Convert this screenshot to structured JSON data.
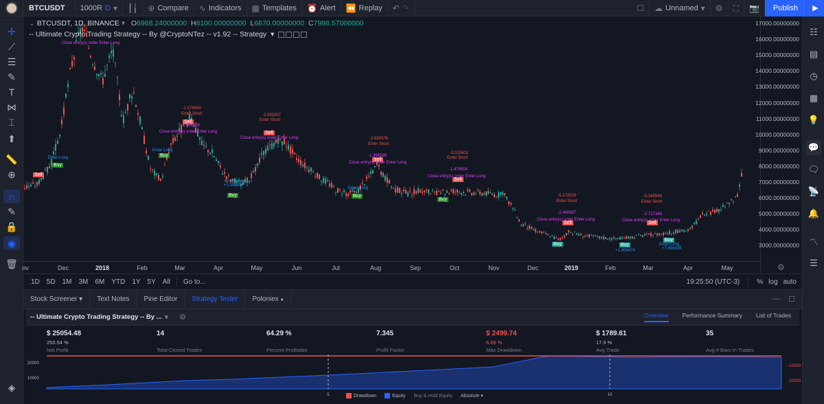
{
  "topbar": {
    "symbol": "BTCUSDT",
    "bars": "1000R",
    "interval": "D",
    "compare": "Compare",
    "indicators": "Indicators",
    "templates": "Templates",
    "alert": "Alert",
    "replay": "Replay",
    "layout_name": "Unnamed",
    "publish": "Publish"
  },
  "legend": {
    "title": "BTCUSDT, 1D, BINANCE",
    "open": "6968.24000000",
    "high": "8100.00000000",
    "low": "6870.00000000",
    "close": "7998.57000000",
    "strategy": "-- Ultimate Crypto Trading Strategy -- By @CryptoNTez -- v1.92 -- Strategy"
  },
  "price_axis": [
    "17000.00000000",
    "16000.00000000",
    "15000.00000000",
    "14000.00000000",
    "13000.00000000",
    "12000.00000000",
    "11000.00000000",
    "10000.00000000",
    "9000.00000000",
    "8000.00000000",
    "7000.00000000",
    "6000.00000000",
    "5000.00000000",
    "4000.00000000",
    "3000.00000000"
  ],
  "time_axis": [
    {
      "label": "ov",
      "bold": false
    },
    {
      "label": "Dec",
      "bold": false
    },
    {
      "label": "2018",
      "bold": true
    },
    {
      "label": "Feb",
      "bold": false
    },
    {
      "label": "Mar",
      "bold": false
    },
    {
      "label": "Apr",
      "bold": false
    },
    {
      "label": "May",
      "bold": false
    },
    {
      "label": "Jun",
      "bold": false
    },
    {
      "label": "Jul",
      "bold": false
    },
    {
      "label": "Aug",
      "bold": false
    },
    {
      "label": "Sep",
      "bold": false
    },
    {
      "label": "Oct",
      "bold": false
    },
    {
      "label": "Nov",
      "bold": false
    },
    {
      "label": "Dec",
      "bold": false
    },
    {
      "label": "2019",
      "bold": true
    },
    {
      "label": "Feb",
      "bold": false
    },
    {
      "label": "Mar",
      "bold": false
    },
    {
      "label": "Apr",
      "bold": false
    },
    {
      "label": "May",
      "bold": false
    }
  ],
  "signals": {
    "buy": "Buy",
    "sell": "Sell",
    "enter_long": "Enter Long",
    "enter_short": "Enter Short",
    "close_entry": "Close entry(s) order Enter Long",
    "short_values": [
      "-1.078940",
      "-2.392907",
      "-2.693376",
      "-3.015602",
      "-5.272528",
      "-5.345568"
    ],
    "close_values": [
      "-1.906993",
      "-1.366598",
      "-1.479504",
      "-2.469367",
      "-2.717346"
    ],
    "long_values": [
      "+0.340696",
      "+1.909474",
      "+7.859036"
    ]
  },
  "rangebar": {
    "ranges": [
      "1D",
      "5D",
      "1M",
      "3M",
      "6M",
      "YTD",
      "1Y",
      "5Y",
      "All"
    ],
    "goto": "Go to...",
    "time": "19:25:50 (UTC-3)",
    "percent": "%",
    "log": "log",
    "auto": "auto"
  },
  "panel": {
    "tabs": [
      "Stock Screener",
      "Text Notes",
      "Pine Editor",
      "Strategy Tester",
      "Poloniex"
    ],
    "active_tab": "Strategy Tester",
    "strategy_name": "-- Ultimate Crypto Trading Strategy -- By ...",
    "subtabs": [
      "Overview",
      "Performance Summary",
      "List of Trades"
    ],
    "metrics": [
      {
        "value": "$ 25054.48",
        "pct": "250.54 %",
        "label": "Net Profit",
        "red": false
      },
      {
        "value": "14",
        "pct": "",
        "label": "Total Closed Trades",
        "red": false
      },
      {
        "value": "64.29 %",
        "pct": "",
        "label": "Percent Profitable",
        "red": false
      },
      {
        "value": "7.345",
        "pct": "",
        "label": "Profit Factor",
        "red": false
      },
      {
        "value": "$ 2499.74",
        "pct": "6.66 %",
        "label": "Max Drawdown",
        "red": true
      },
      {
        "value": "$ 1789.61",
        "pct": "17.9 %",
        "label": "Avg Trade",
        "red": false
      },
      {
        "value": "35",
        "pct": "",
        "label": "Avg # Bars In Trades",
        "red": false
      }
    ],
    "equity_axis_left": [
      "20000",
      "10000"
    ],
    "equity_axis_right": [
      "-10000",
      "-20000"
    ],
    "equity_x": [
      "5",
      "10"
    ],
    "legend": {
      "drawdown": "Drawdown",
      "equity": "Equity",
      "buyhold": "Buy & Hold Equity",
      "mode": "Absolute"
    },
    "colors": {
      "drawdown": "#ef5350",
      "equity": "#2962ff"
    }
  }
}
